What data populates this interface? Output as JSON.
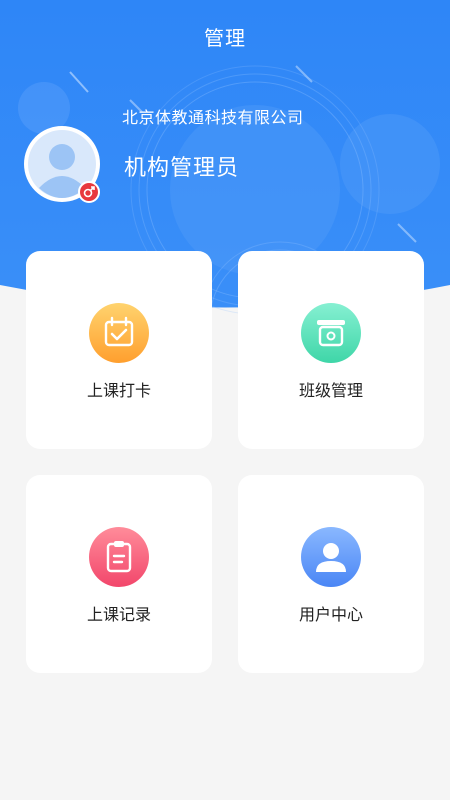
{
  "header": {
    "title": "管理",
    "company": "北京体教通科技有限公司",
    "role": "机构管理员"
  },
  "avatar": {
    "icon": "user-avatar-icon",
    "badge_icon": "male-gender-icon",
    "badge_color": "#e8383d"
  },
  "cards": [
    {
      "label": "上课打卡",
      "icon": "calendar-check-icon",
      "color_top": "#ffd36e",
      "color_bottom": "#ff9f2e"
    },
    {
      "label": "班级管理",
      "icon": "classroom-icon",
      "color_top": "#86f0d2",
      "color_bottom": "#3fd6a8"
    },
    {
      "label": "上课记录",
      "icon": "clipboard-icon",
      "color_top": "#ff8c9a",
      "color_bottom": "#f2466b"
    },
    {
      "label": "用户中心",
      "icon": "person-icon",
      "color_top": "#8ab8ff",
      "color_bottom": "#4a86f5"
    }
  ],
  "colors": {
    "primary": "#2f86f6",
    "background": "#f5f5f5"
  }
}
